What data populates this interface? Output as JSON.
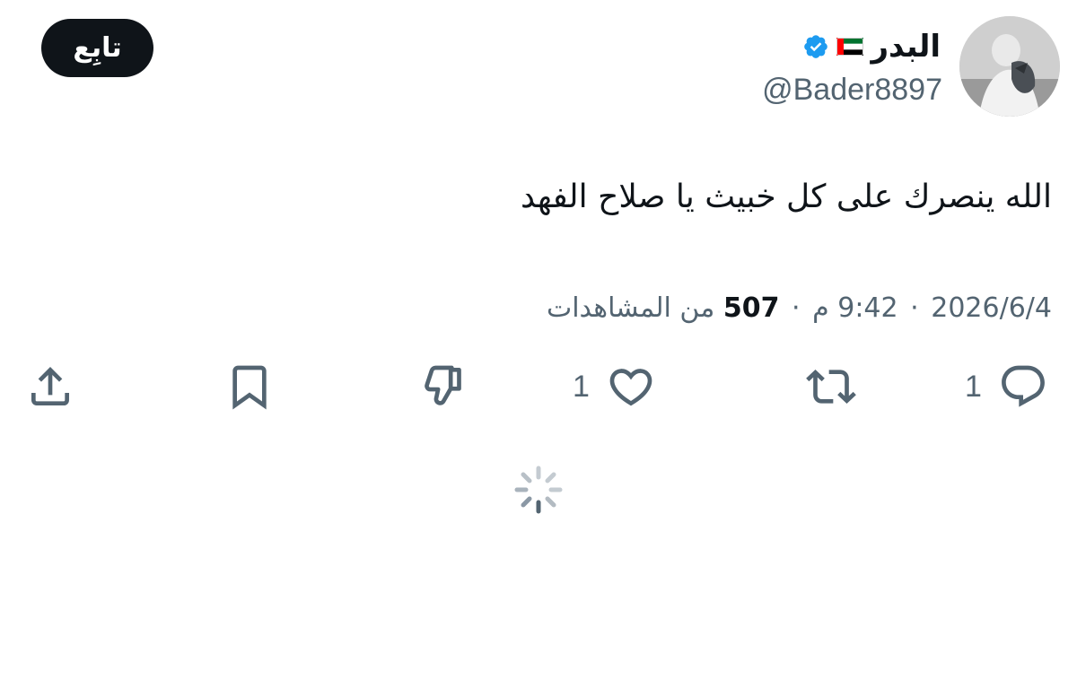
{
  "user": {
    "display_name": "البدر",
    "handle": "@Bader8897",
    "verified": true,
    "flag": "uae-flag-icon"
  },
  "follow_button": {
    "label": "تابِع"
  },
  "tweet": {
    "text": "الله ينصرك على كل خبيث يا صلاح الفهد"
  },
  "meta": {
    "date": "2026/6/4",
    "time": "9:42 م",
    "separator": "·",
    "views_count": "507",
    "views_label": "من المشاهدات"
  },
  "actions": {
    "reply_count": "1",
    "like_count": "1"
  },
  "colors": {
    "text_primary": "#0f1419",
    "text_secondary": "#536471",
    "verified_blue": "#1d9bf0",
    "follow_bg": "#0f1419"
  },
  "icons": {
    "reply": "reply-icon",
    "retweet": "retweet-icon",
    "like": "heart-icon",
    "dislike": "thumbs-down-icon",
    "bookmark": "bookmark-icon",
    "share": "share-icon",
    "loading": "loading-spinner-icon"
  }
}
